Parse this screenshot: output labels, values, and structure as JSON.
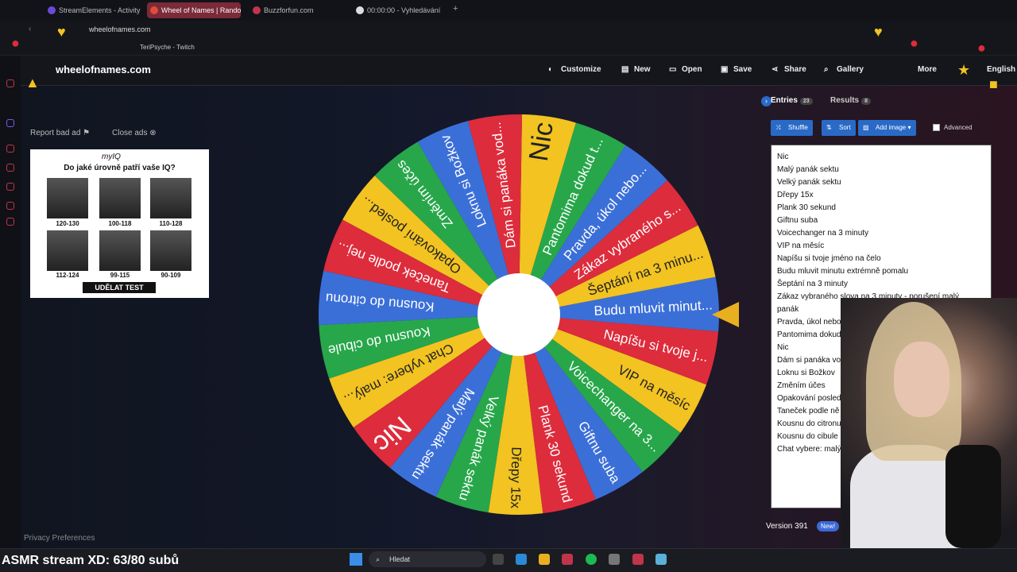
{
  "browser": {
    "tabs": [
      "StreamElements - Activity",
      "Wheel of Names | Random",
      "Buzzforfun.com",
      "00:00:00 - Vyhledávání"
    ],
    "url": "wheelofnames.com",
    "bookmarks": [
      "TeriPsyche - Twitch"
    ]
  },
  "site": {
    "title": "wheelofnames.com",
    "nav": [
      "Customize",
      "New",
      "Open",
      "Save",
      "Share",
      "Gallery",
      "More",
      "English"
    ]
  },
  "ads": {
    "report": "Report bad ad",
    "close": "Close ads",
    "logo": "myIQ",
    "question": "Do jaké úrovně patří vaše IQ?",
    "captions": [
      "120-130",
      "100-118",
      "110-128",
      "112-124",
      "99-115",
      "90-109"
    ],
    "button": "UDĚLAT TEST"
  },
  "privacy": "Privacy Preferences",
  "panel": {
    "tab_entries": "Entries",
    "entries_count": "23",
    "tab_results": "Results",
    "results_count": "8",
    "buttons": [
      "Shuffle",
      "Sort",
      "Add image"
    ],
    "advanced": "Advanced",
    "entries": [
      "Nic",
      "Malý panák sektu",
      "Velký panák sektu",
      "Dřepy 15x",
      "Plank 30 sekund",
      "Giftnu suba",
      "Voicechanger na 3 minuty",
      "VIP na měsíc",
      "Napíšu si tvoje jméno na čelo",
      "Budu mluvit minutu extrémně pomalu",
      "Šeptání na 3 minuty",
      "Zákaz vybraného slova na 3 minuty - porušení malý",
      "panák",
      "Pravda, úkol nebo",
      "Pantomima dokud",
      "Nic",
      "Dám si panáka vo",
      "Loknu si Božkov",
      "Změním účes",
      "Opakování posled",
      "Taneček podle ně",
      "Kousnu do citronu",
      "Kousnu do cibule",
      "Chat vybere: malý"
    ],
    "version": "Version 391",
    "new_badge": "New!"
  },
  "wheel": {
    "colors": [
      "#f2c321",
      "#dd2c3c",
      "#3b6fd8",
      "#27a74a"
    ],
    "slices": [
      "Šeptání na 3 minu...",
      "Zákaz vybraného s...",
      "Pravda, úkol nebo...",
      "Pantomima dokud t...",
      "Nic",
      "Dám si panáka vod...",
      "Loknu si Božkov",
      "Změním účes",
      "Opakování posled...",
      "Taneček podle nej...",
      "Kousnu do citronu",
      "Kousnu do cibule",
      "Chat vybere: malý...",
      "Nic",
      "Malý panák sektu",
      "Velký panák sektu",
      "Dřepy 15x",
      "Plank 30 sekund",
      "Giftnu suba",
      "Voicechanger na 3...",
      "VIP na měsíc",
      "Napíšu si tvoje j...",
      "Budu mluvit minut..."
    ]
  },
  "taskbar": {
    "search": "Hledat",
    "overlay": "ASMR stream XD: 63/80 subů"
  }
}
